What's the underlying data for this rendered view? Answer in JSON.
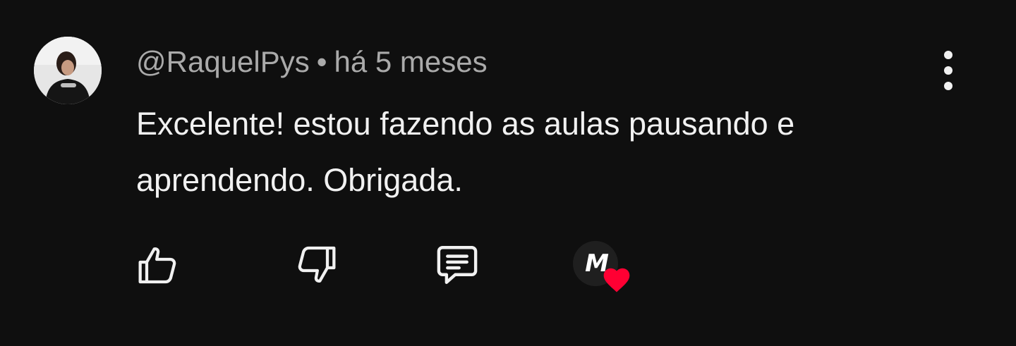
{
  "comment": {
    "author": "@RaquelPys",
    "separator": "•",
    "time": "há 5 meses",
    "text": "Excelente! estou fazendo as aulas pausando e aprendendo. Obrigada."
  },
  "actions": {
    "like_icon": "thumbs-up-icon",
    "dislike_icon": "thumbs-down-icon",
    "reply_icon": "comment-icon",
    "creator_heart_icon": "heart-icon",
    "creator_badge_text": "M"
  },
  "colors": {
    "background": "#0f0f0f",
    "text": "#f1f1f1",
    "meta": "#aaaaaa",
    "heart": "#ff0033"
  }
}
